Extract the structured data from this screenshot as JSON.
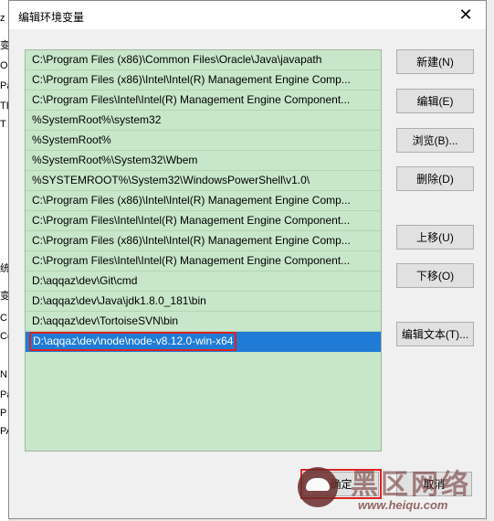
{
  "background_left": [
    "z",
    "变",
    "O",
    "Pa",
    "TE",
    "T"
  ],
  "background_left_lower": [
    "统",
    "变",
    "C",
    "Co",
    "N",
    "Pa",
    "P",
    "PA"
  ],
  "dialog": {
    "title": "编辑环境变量",
    "close_symbol": "✕",
    "paths": [
      "C:\\Program Files (x86)\\Common Files\\Oracle\\Java\\javapath",
      "C:\\Program Files (x86)\\Intel\\Intel(R) Management Engine Comp...",
      "C:\\Program Files\\Intel\\Intel(R) Management Engine Component...",
      "%SystemRoot%\\system32",
      "%SystemRoot%",
      "%SystemRoot%\\System32\\Wbem",
      "%SYSTEMROOT%\\System32\\WindowsPowerShell\\v1.0\\",
      "C:\\Program Files (x86)\\Intel\\Intel(R) Management Engine Comp...",
      "C:\\Program Files\\Intel\\Intel(R) Management Engine Component...",
      "C:\\Program Files (x86)\\Intel\\Intel(R) Management Engine Comp...",
      "C:\\Program Files\\Intel\\Intel(R) Management Engine Component...",
      "D:\\aqqaz\\dev\\Git\\cmd",
      "D:\\aqqaz\\dev\\Java\\jdk1.8.0_181\\bin",
      "D:\\aqqaz\\dev\\TortoiseSVN\\bin",
      "D:\\aqqaz\\dev\\node\\node-v8.12.0-win-x64"
    ],
    "selected_index": 14,
    "buttons": {
      "new": "新建(N)",
      "edit": "编辑(E)",
      "browse": "浏览(B)...",
      "delete": "删除(D)",
      "move_up": "上移(U)",
      "move_down": "下移(O)",
      "edit_text": "编辑文本(T)...",
      "ok": "确定",
      "cancel": "取消"
    }
  },
  "watermark": {
    "title": "黑区网络",
    "url": "www.heiqu.com"
  },
  "colors": {
    "list_background": "#c8e6c9",
    "selection": "#1f7bd6",
    "highlight_box": "#e02020"
  }
}
